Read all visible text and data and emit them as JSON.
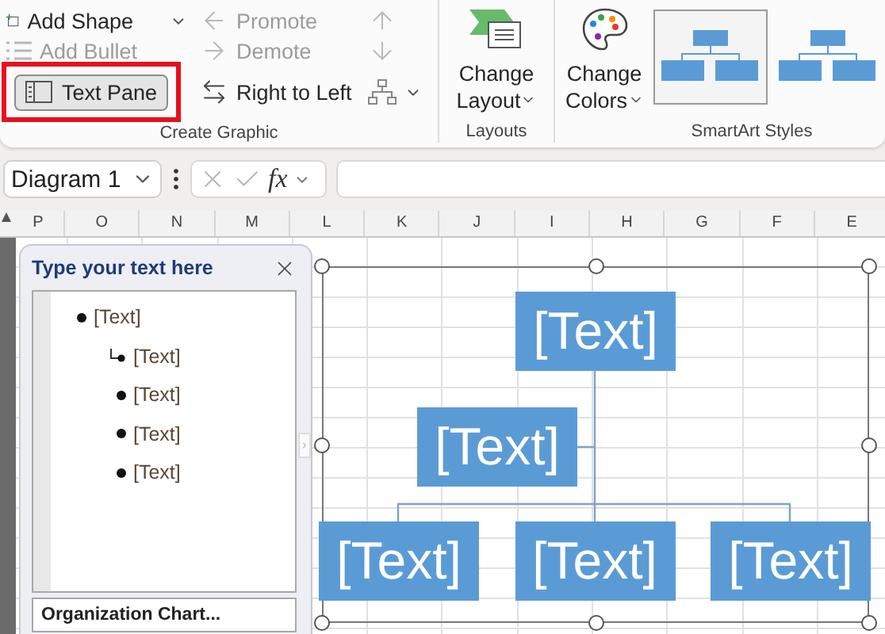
{
  "ribbon": {
    "create_graphic": {
      "label": "Create Graphic",
      "commands": [
        {
          "kind": "add_shape",
          "label": "Add Shape",
          "disabled": false,
          "dropdown": true
        },
        {
          "kind": "add_bullet",
          "label": "Add Bullet",
          "disabled": true
        },
        {
          "kind": "text_pane",
          "label": "Text Pane",
          "active": true,
          "highlighted": true
        },
        {
          "kind": "promote",
          "label": "Promote",
          "disabled": true
        },
        {
          "kind": "demote",
          "label": "Demote",
          "disabled": true
        },
        {
          "kind": "right_to_left",
          "label": "Right to Left",
          "disabled": false
        },
        {
          "kind": "move_up",
          "disabled": true
        },
        {
          "kind": "move_down",
          "disabled": true
        },
        {
          "kind": "layout",
          "disabled": false,
          "dropdown": true
        }
      ]
    },
    "layouts": {
      "label": "Layouts",
      "button": {
        "label": "Change Layout",
        "dropdown": true
      }
    },
    "smartart_styles": {
      "label": "SmartArt Styles",
      "colors_button": {
        "label": "Change Colors",
        "dropdown": true
      },
      "thumbnails": [
        {
          "selected": true
        },
        {
          "selected": false
        }
      ]
    }
  },
  "formula_bar": {
    "name_box": "Diagram 1",
    "function_label": "fx"
  },
  "columns": [
    "P",
    "O",
    "N",
    "M",
    "L",
    "K",
    "J",
    "I",
    "H",
    "G",
    "F",
    "E"
  ],
  "text_pane": {
    "title": "Type your text here",
    "items": [
      {
        "kind": "bullet",
        "text": "[Text]",
        "children": [
          {
            "kind": "assistant",
            "text": "[Text]"
          },
          {
            "kind": "bullet",
            "text": "[Text]"
          },
          {
            "kind": "bullet",
            "text": "[Text]"
          },
          {
            "kind": "bullet",
            "text": "[Text]"
          }
        ]
      }
    ],
    "footer": "Organization Chart..."
  },
  "diagram": {
    "nodes": [
      {
        "kind": "root",
        "text": "[Text]"
      },
      {
        "kind": "assistant",
        "text": "[Text]"
      },
      {
        "kind": "child",
        "text": "[Text]"
      },
      {
        "kind": "child",
        "text": "[Text]"
      },
      {
        "kind": "child",
        "text": "[Text]"
      }
    ]
  }
}
